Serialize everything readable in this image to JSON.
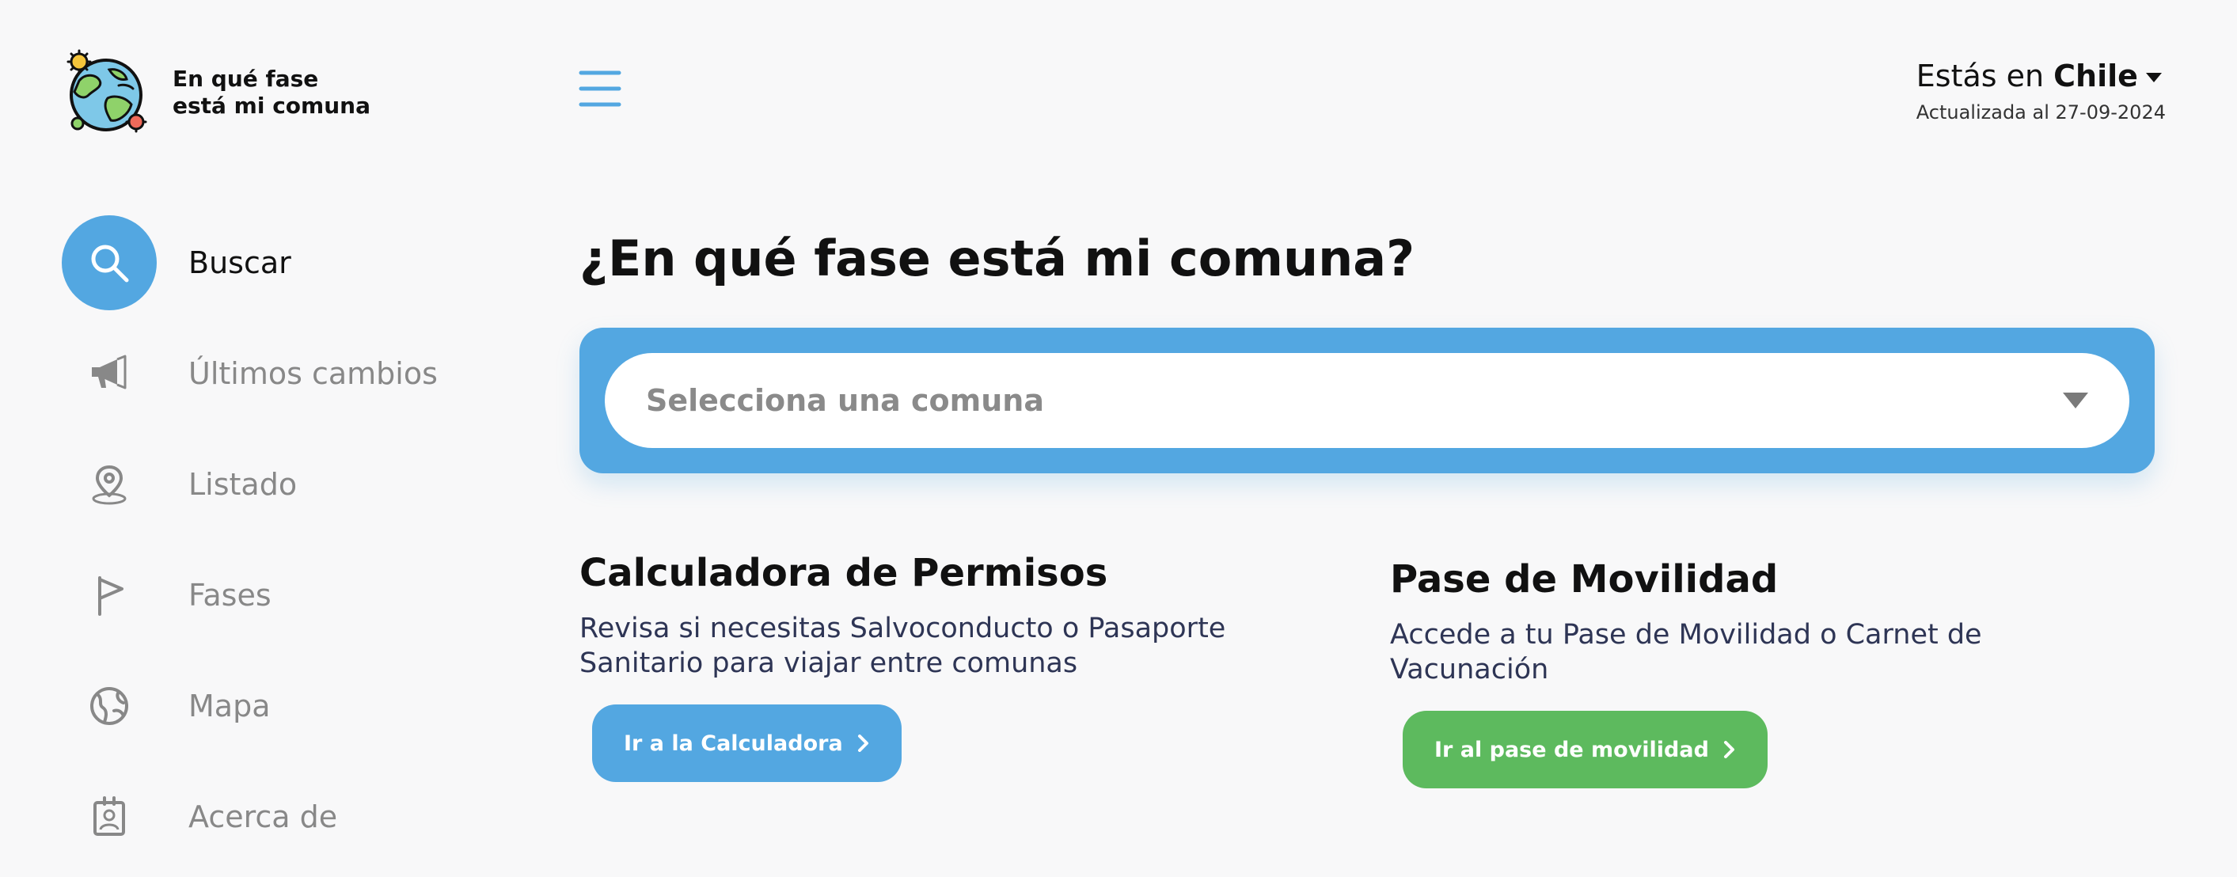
{
  "brand": {
    "line1": "En qué fase",
    "line2": "está mi comuna",
    "icon": "globe-virus-logo"
  },
  "header": {
    "menu_icon": "hamburger-icon",
    "location_prefix": "Estás en",
    "location_country": "Chile",
    "updated": "Actualizada al 27-09-2024"
  },
  "sidebar": {
    "items": [
      {
        "label": "Buscar",
        "icon": "search-icon",
        "active": true
      },
      {
        "label": "Últimos cambios",
        "icon": "megaphone-icon",
        "active": false
      },
      {
        "label": "Listado",
        "icon": "location-pin-icon",
        "active": false
      },
      {
        "label": "Fases",
        "icon": "flag-icon",
        "active": false
      },
      {
        "label": "Mapa",
        "icon": "globe-icon",
        "active": false
      },
      {
        "label": "Acerca de",
        "icon": "id-badge-icon",
        "active": false
      }
    ]
  },
  "main": {
    "title": "¿En qué fase está mi comuna?",
    "select_placeholder": "Selecciona una comuna",
    "cards": [
      {
        "title": "Calculadora de Permisos",
        "description": "Revisa si necesitas Salvoconducto o Pasaporte Sanitario para viajar entre comunas",
        "button": "Ir a la Calculadora"
      },
      {
        "title": "Pase de Movilidad",
        "description": "Accede a tu Pase de Movilidad o Carnet de Vacunación",
        "button": "Ir al pase de movilidad"
      }
    ]
  },
  "colors": {
    "accent_blue": "#53a7e1",
    "accent_green": "#5dba5e",
    "background": "#f8f8f9",
    "muted_text": "#888888",
    "description_text": "#2e3555"
  }
}
